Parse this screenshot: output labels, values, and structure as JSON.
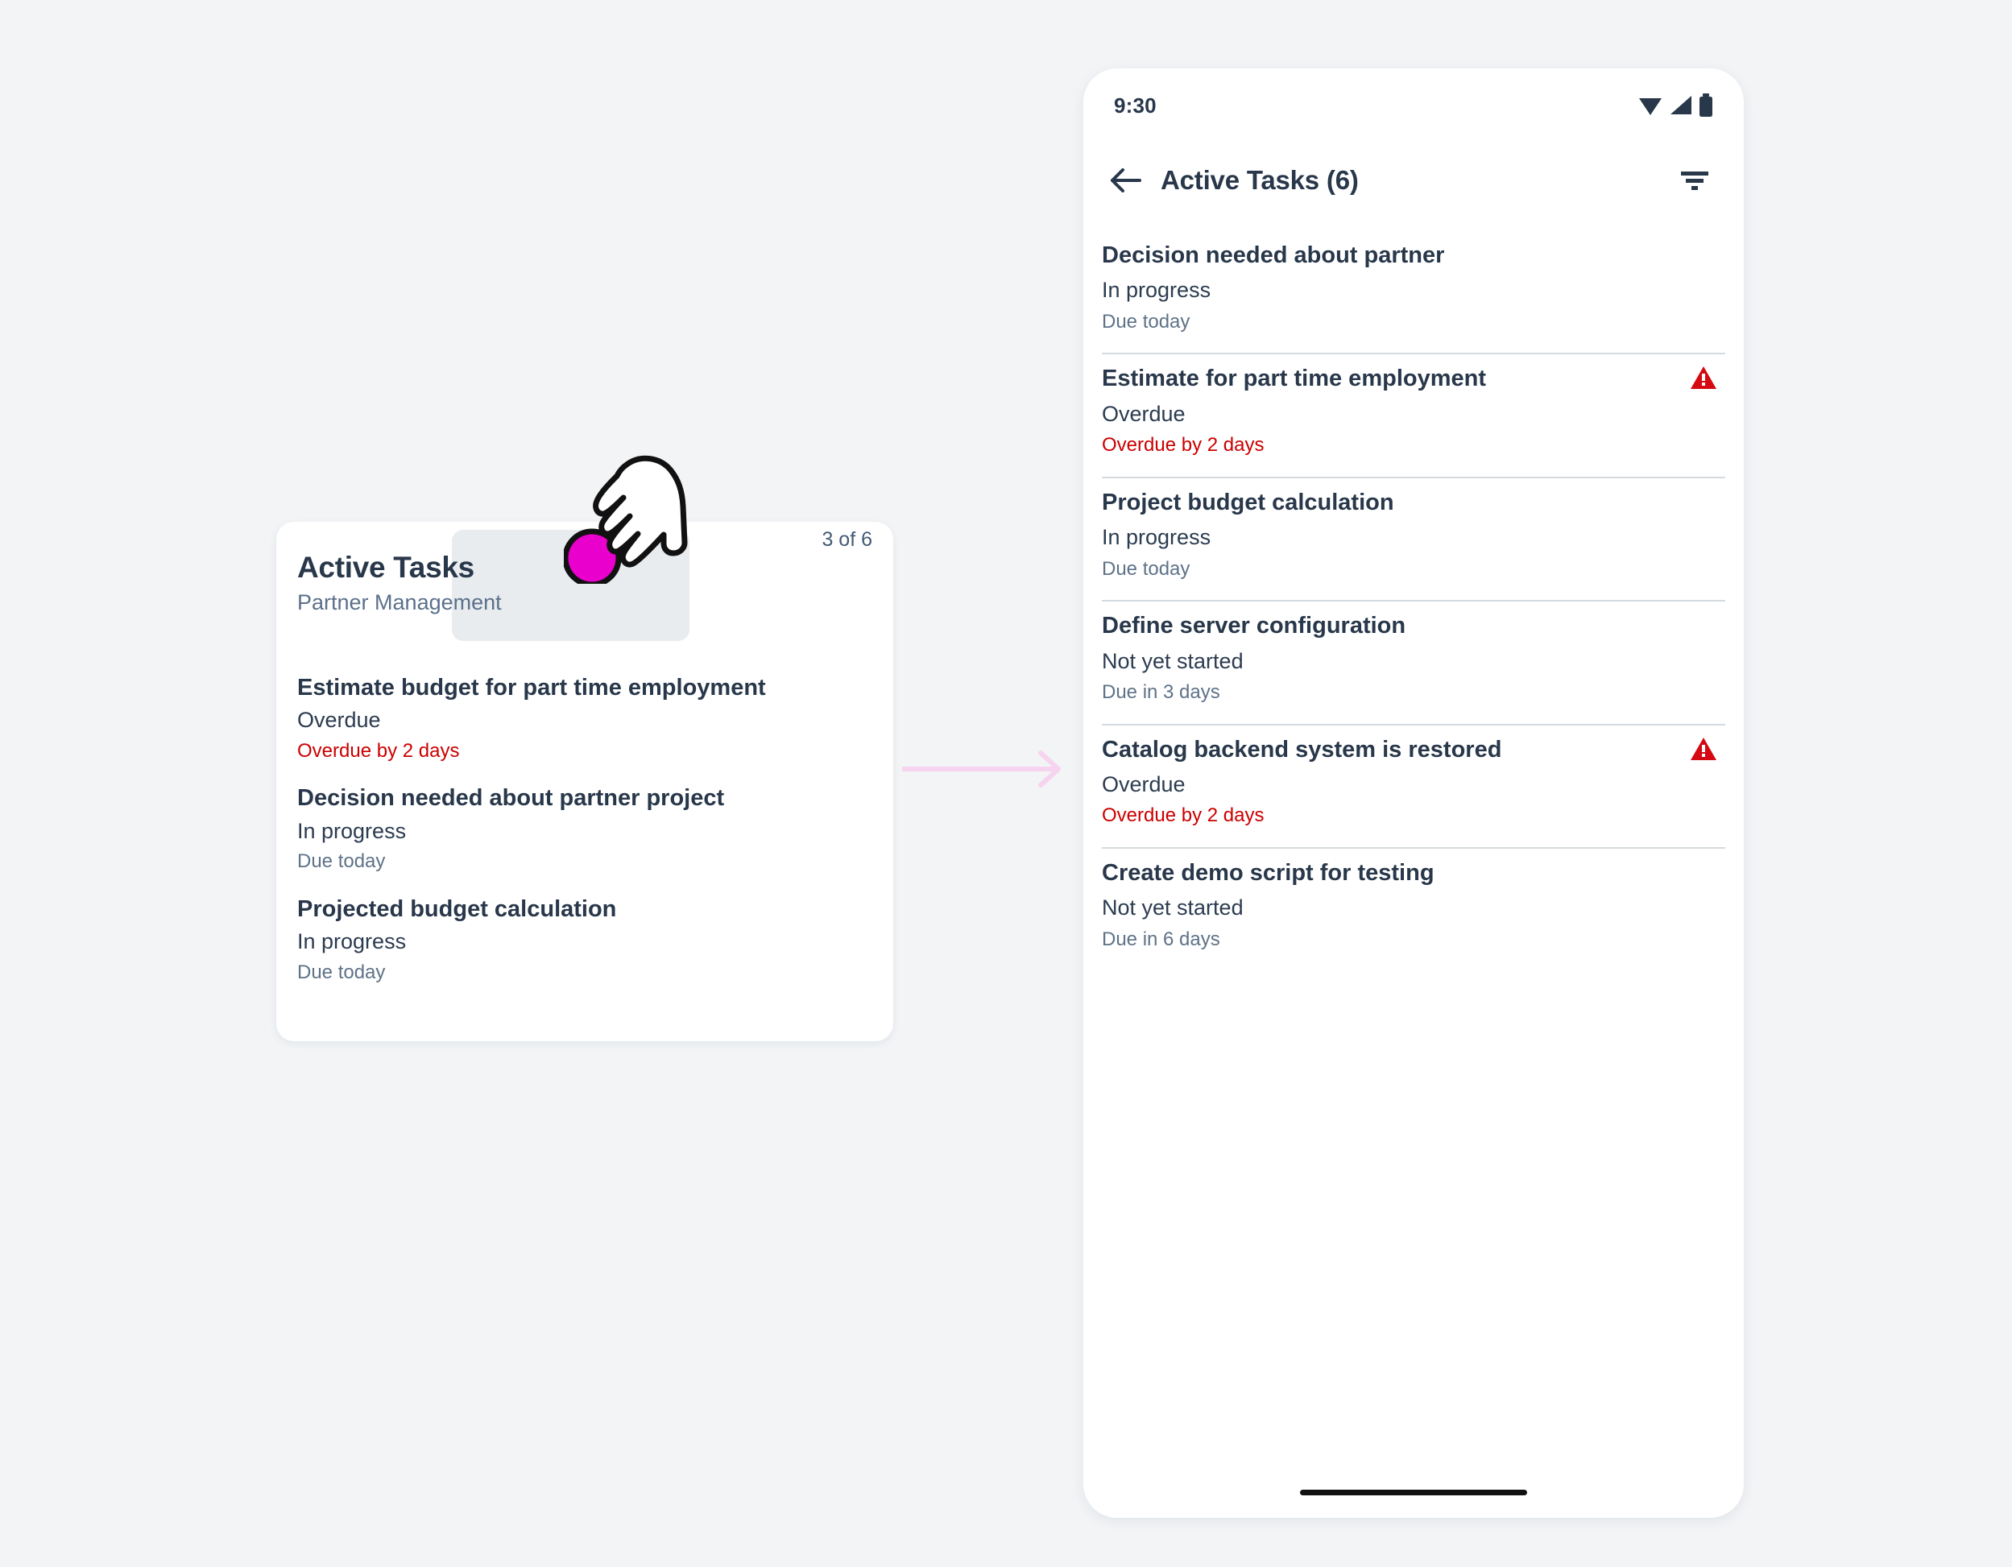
{
  "canvas": {
    "background_color": "#f2f4f6",
    "accent_pink": "#ea00cc",
    "overdue_red": "#cc0000",
    "text_dark": "#28374a",
    "text_muted": "#5e7288",
    "arrow_color": "#f6d4ef"
  },
  "card": {
    "title": "Active Tasks",
    "subtitle": "Partner Management",
    "count": "3 of 6",
    "tasks": [
      {
        "title": "Estimate budget for part time employment",
        "status": "Overdue",
        "due": "Overdue by 2 days",
        "overdue": true
      },
      {
        "title": "Decision needed about partner project",
        "status": "In progress",
        "due": "Due today",
        "overdue": false
      },
      {
        "title": "Projected budget calculation",
        "status": "In progress",
        "due": "Due today",
        "overdue": false
      }
    ]
  },
  "cursor": {
    "icon": "pointing-hand-icon",
    "tap_dot_color": "#ea00cc"
  },
  "arrow": {
    "icon": "arrow-right-icon"
  },
  "phone": {
    "status_bar": {
      "time": "9:30",
      "icons": [
        "wifi-icon",
        "cellular-signal-icon",
        "battery-icon"
      ]
    },
    "app_bar": {
      "back_icon": "arrow-left-icon",
      "title": "Active Tasks (6)",
      "filter_icon": "filter-icon"
    },
    "tasks": [
      {
        "title": "Decision needed about partner",
        "status": "In progress",
        "due": "Due today",
        "overdue": false,
        "warning": false
      },
      {
        "title": "Estimate for part time employment",
        "status": "Overdue",
        "due": "Overdue by 2 days",
        "overdue": true,
        "warning": true
      },
      {
        "title": "Project budget calculation",
        "status": "In progress",
        "due": "Due today",
        "overdue": false,
        "warning": false
      },
      {
        "title": "Define server configuration",
        "status": "Not yet started",
        "due": "Due in 3 days",
        "overdue": false,
        "warning": false
      },
      {
        "title": "Catalog backend system is restored",
        "status": "Overdue",
        "due": "Overdue by 2 days",
        "overdue": true,
        "warning": true
      },
      {
        "title": "Create demo script for testing",
        "status": "Not yet started",
        "due": "Due in 6 days",
        "overdue": false,
        "warning": false
      }
    ],
    "home_indicator": "home-indicator"
  }
}
